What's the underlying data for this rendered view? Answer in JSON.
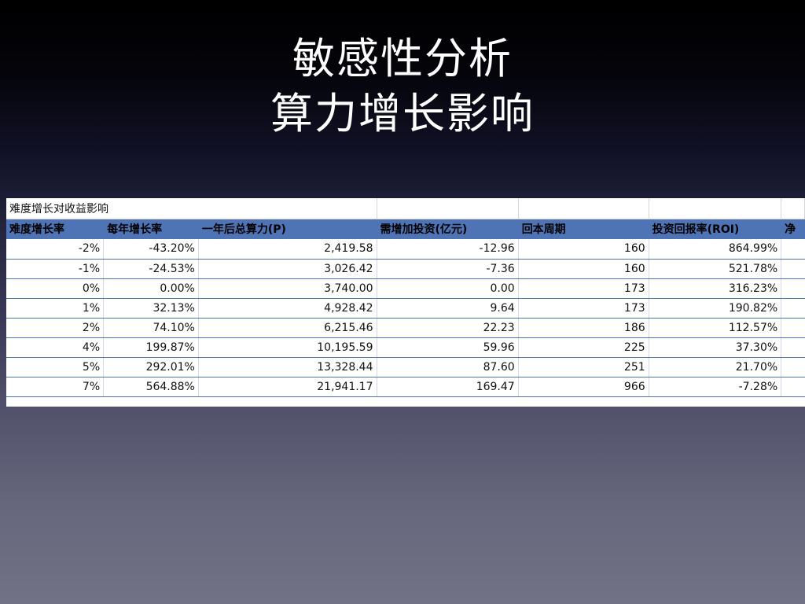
{
  "title": {
    "line1": "敏感性分析",
    "line2": "算力增长影响"
  },
  "sheet": {
    "caption": "难度增长对收益影响",
    "headers": [
      "难度增长率",
      "每年增长率",
      "一年后总算力(P)",
      "需增加投资(亿元)",
      "回本周期",
      "投资回报率(ROI)",
      "净"
    ],
    "rows": [
      [
        "-2%",
        "-43.20%",
        "2,419.58",
        "-12.96",
        "160",
        "864.99%",
        ""
      ],
      [
        "-1%",
        "-24.53%",
        "3,026.42",
        "-7.36",
        "160",
        "521.78%",
        ""
      ],
      [
        "0%",
        "0.00%",
        "3,740.00",
        "0.00",
        "173",
        "316.23%",
        ""
      ],
      [
        "1%",
        "32.13%",
        "4,928.42",
        "9.64",
        "173",
        "190.82%",
        ""
      ],
      [
        "2%",
        "74.10%",
        "6,215.46",
        "22.23",
        "186",
        "112.57%",
        ""
      ],
      [
        "4%",
        "199.87%",
        "10,195.59",
        "59.96",
        "225",
        "37.30%",
        ""
      ],
      [
        "5%",
        "292.01%",
        "13,328.44",
        "87.60",
        "251",
        "21.70%",
        ""
      ],
      [
        "7%",
        "564.88%",
        "21,941.17",
        "169.47",
        "966",
        "-7.28%",
        ""
      ]
    ]
  }
}
